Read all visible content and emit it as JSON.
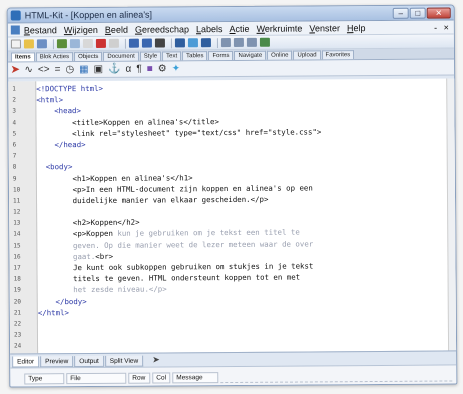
{
  "window": {
    "title": "HTML-Kit - [Koppen en alinea's]"
  },
  "menubar": {
    "items": [
      "Bestand",
      "Wijzigen",
      "Beeld",
      "Gereedschap",
      "Labels",
      "Actie",
      "Werkruimte",
      "Venster",
      "Help"
    ],
    "right": "- ×"
  },
  "tabstrip": {
    "tabs": [
      "Items",
      "Blok Acties",
      "Objects",
      "Document",
      "Style",
      "Text",
      "Tables",
      "Forms",
      "Navigate",
      "Online",
      "Upload",
      "Favorites"
    ]
  },
  "editor": {
    "lines": [
      {
        "n": "1",
        "parts": [
          [
            "tag",
            "<!DOCTYPE html>"
          ]
        ]
      },
      {
        "n": "2",
        "parts": [
          [
            "tag",
            "<html>"
          ]
        ]
      },
      {
        "n": "3",
        "parts": [
          [
            "tag",
            "    <head>"
          ]
        ]
      },
      {
        "n": "4",
        "parts": [
          [
            "txt",
            "        <title>Koppen en alinea's</title>"
          ]
        ]
      },
      {
        "n": "5",
        "parts": [
          [
            "txt",
            "        <link rel=\"stylesheet\" type=\"text/css\" href=\"style.css\">"
          ]
        ]
      },
      {
        "n": "6",
        "parts": [
          [
            "tag",
            "    </head>"
          ]
        ]
      },
      {
        "n": "7",
        "parts": []
      },
      {
        "n": "8",
        "parts": [
          [
            "tag",
            "  <body>"
          ]
        ]
      },
      {
        "n": "9",
        "parts": [
          [
            "txt",
            "        <h1>Koppen en alinea's</h1>"
          ]
        ]
      },
      {
        "n": "10",
        "parts": [
          [
            "txt",
            "        <p>In een HTML-document zijn koppen en alinea's op een"
          ]
        ]
      },
      {
        "n": "11",
        "parts": [
          [
            "txt",
            "        duidelijke manier van elkaar gescheiden.</p>"
          ]
        ]
      },
      {
        "n": "12",
        "parts": []
      },
      {
        "n": "13",
        "parts": [
          [
            "txt",
            "        <h2>Koppen</h2>"
          ]
        ]
      },
      {
        "n": "14",
        "parts": [
          [
            "txt",
            "        <p>Koppen "
          ],
          [
            "blur",
            "kun je gebruiken om je tekst een titel te"
          ]
        ]
      },
      {
        "n": "15",
        "parts": [
          [
            "blur",
            "        geven. Op die manier weet de lezer meteen waar de over"
          ]
        ]
      },
      {
        "n": "16",
        "parts": [
          [
            "blur",
            "        gaat."
          ],
          [
            "txt",
            "<br>"
          ]
        ]
      },
      {
        "n": "17",
        "parts": [
          [
            "txt",
            "        Je kunt ook subkoppen gebruiken om stukjes in je tekst"
          ]
        ]
      },
      {
        "n": "18",
        "parts": [
          [
            "txt",
            "        titels te geven. HTML ondersteunt koppen tot en met"
          ]
        ]
      },
      {
        "n": "19",
        "parts": [
          [
            "blur",
            "        het zesde niveau.</p>"
          ]
        ]
      },
      {
        "n": "20",
        "parts": [
          [
            "tag",
            "    </body>"
          ]
        ]
      },
      {
        "n": "21",
        "parts": [
          [
            "tag",
            "</html>"
          ]
        ]
      },
      {
        "n": "22",
        "parts": []
      },
      {
        "n": "23",
        "parts": []
      },
      {
        "n": "24",
        "parts": []
      }
    ]
  },
  "bottomtabs": {
    "tabs": [
      "Editor",
      "Preview",
      "Output",
      "Split View"
    ]
  },
  "statusbar": {
    "cells": [
      "Type",
      "File",
      "Row",
      "Col",
      "Message"
    ]
  },
  "colors": {
    "tag": "#2b38a6",
    "text": "#111111",
    "blurred": "#9aa0b0"
  }
}
